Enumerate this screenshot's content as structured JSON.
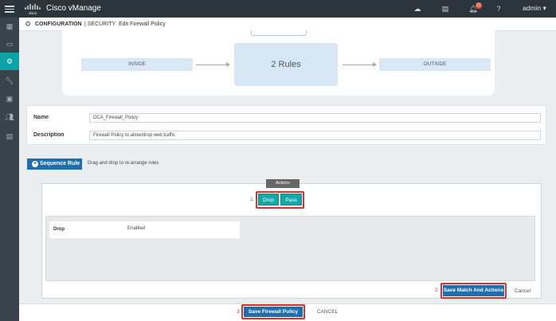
{
  "app": {
    "brand": "Cisco vManage",
    "user": "admin",
    "notification_count": "21"
  },
  "sidebar": {
    "items": [
      "dashboard-icon",
      "monitor-icon",
      "configuration-icon",
      "tools-icon",
      "maintenance-icon",
      "admin-icon",
      "analytics-icon"
    ],
    "active_index": 2
  },
  "breadcrumb": {
    "section": "CONFIGURATION",
    "separator": "|",
    "subsection": "SECURITY",
    "page": "Edit Firewall Policy"
  },
  "diagram": {
    "inside": "INSIDE",
    "rules": "2 Rules",
    "outside": "OUTSIDE"
  },
  "form": {
    "name_label": "Name",
    "name_value": "DCA_Firewall_Policy",
    "description_label": "Description",
    "description_value": "Firewall Policy to allow/drop web traffic"
  },
  "sequence": {
    "button_label": "Sequence Rule",
    "hint": "Drag and drop to re-arrange rules"
  },
  "actions": {
    "tab_label": "Actions",
    "drop_label": "Drop",
    "pass_label": "Pass",
    "rows": [
      {
        "key": "Drop",
        "value": "Enabled"
      }
    ],
    "save_label": "Save Match And Actions",
    "cancel_label": "Cancel"
  },
  "footer": {
    "save_label": "Save Firewall Policy",
    "cancel_label": "CANCEL"
  },
  "callouts": {
    "one": "1",
    "two": "2",
    "three": "3"
  },
  "colors": {
    "accent": "#11a8a8",
    "primary": "#1f6eb0",
    "highlight": "#d9312c",
    "topbar": "#2d353c"
  }
}
